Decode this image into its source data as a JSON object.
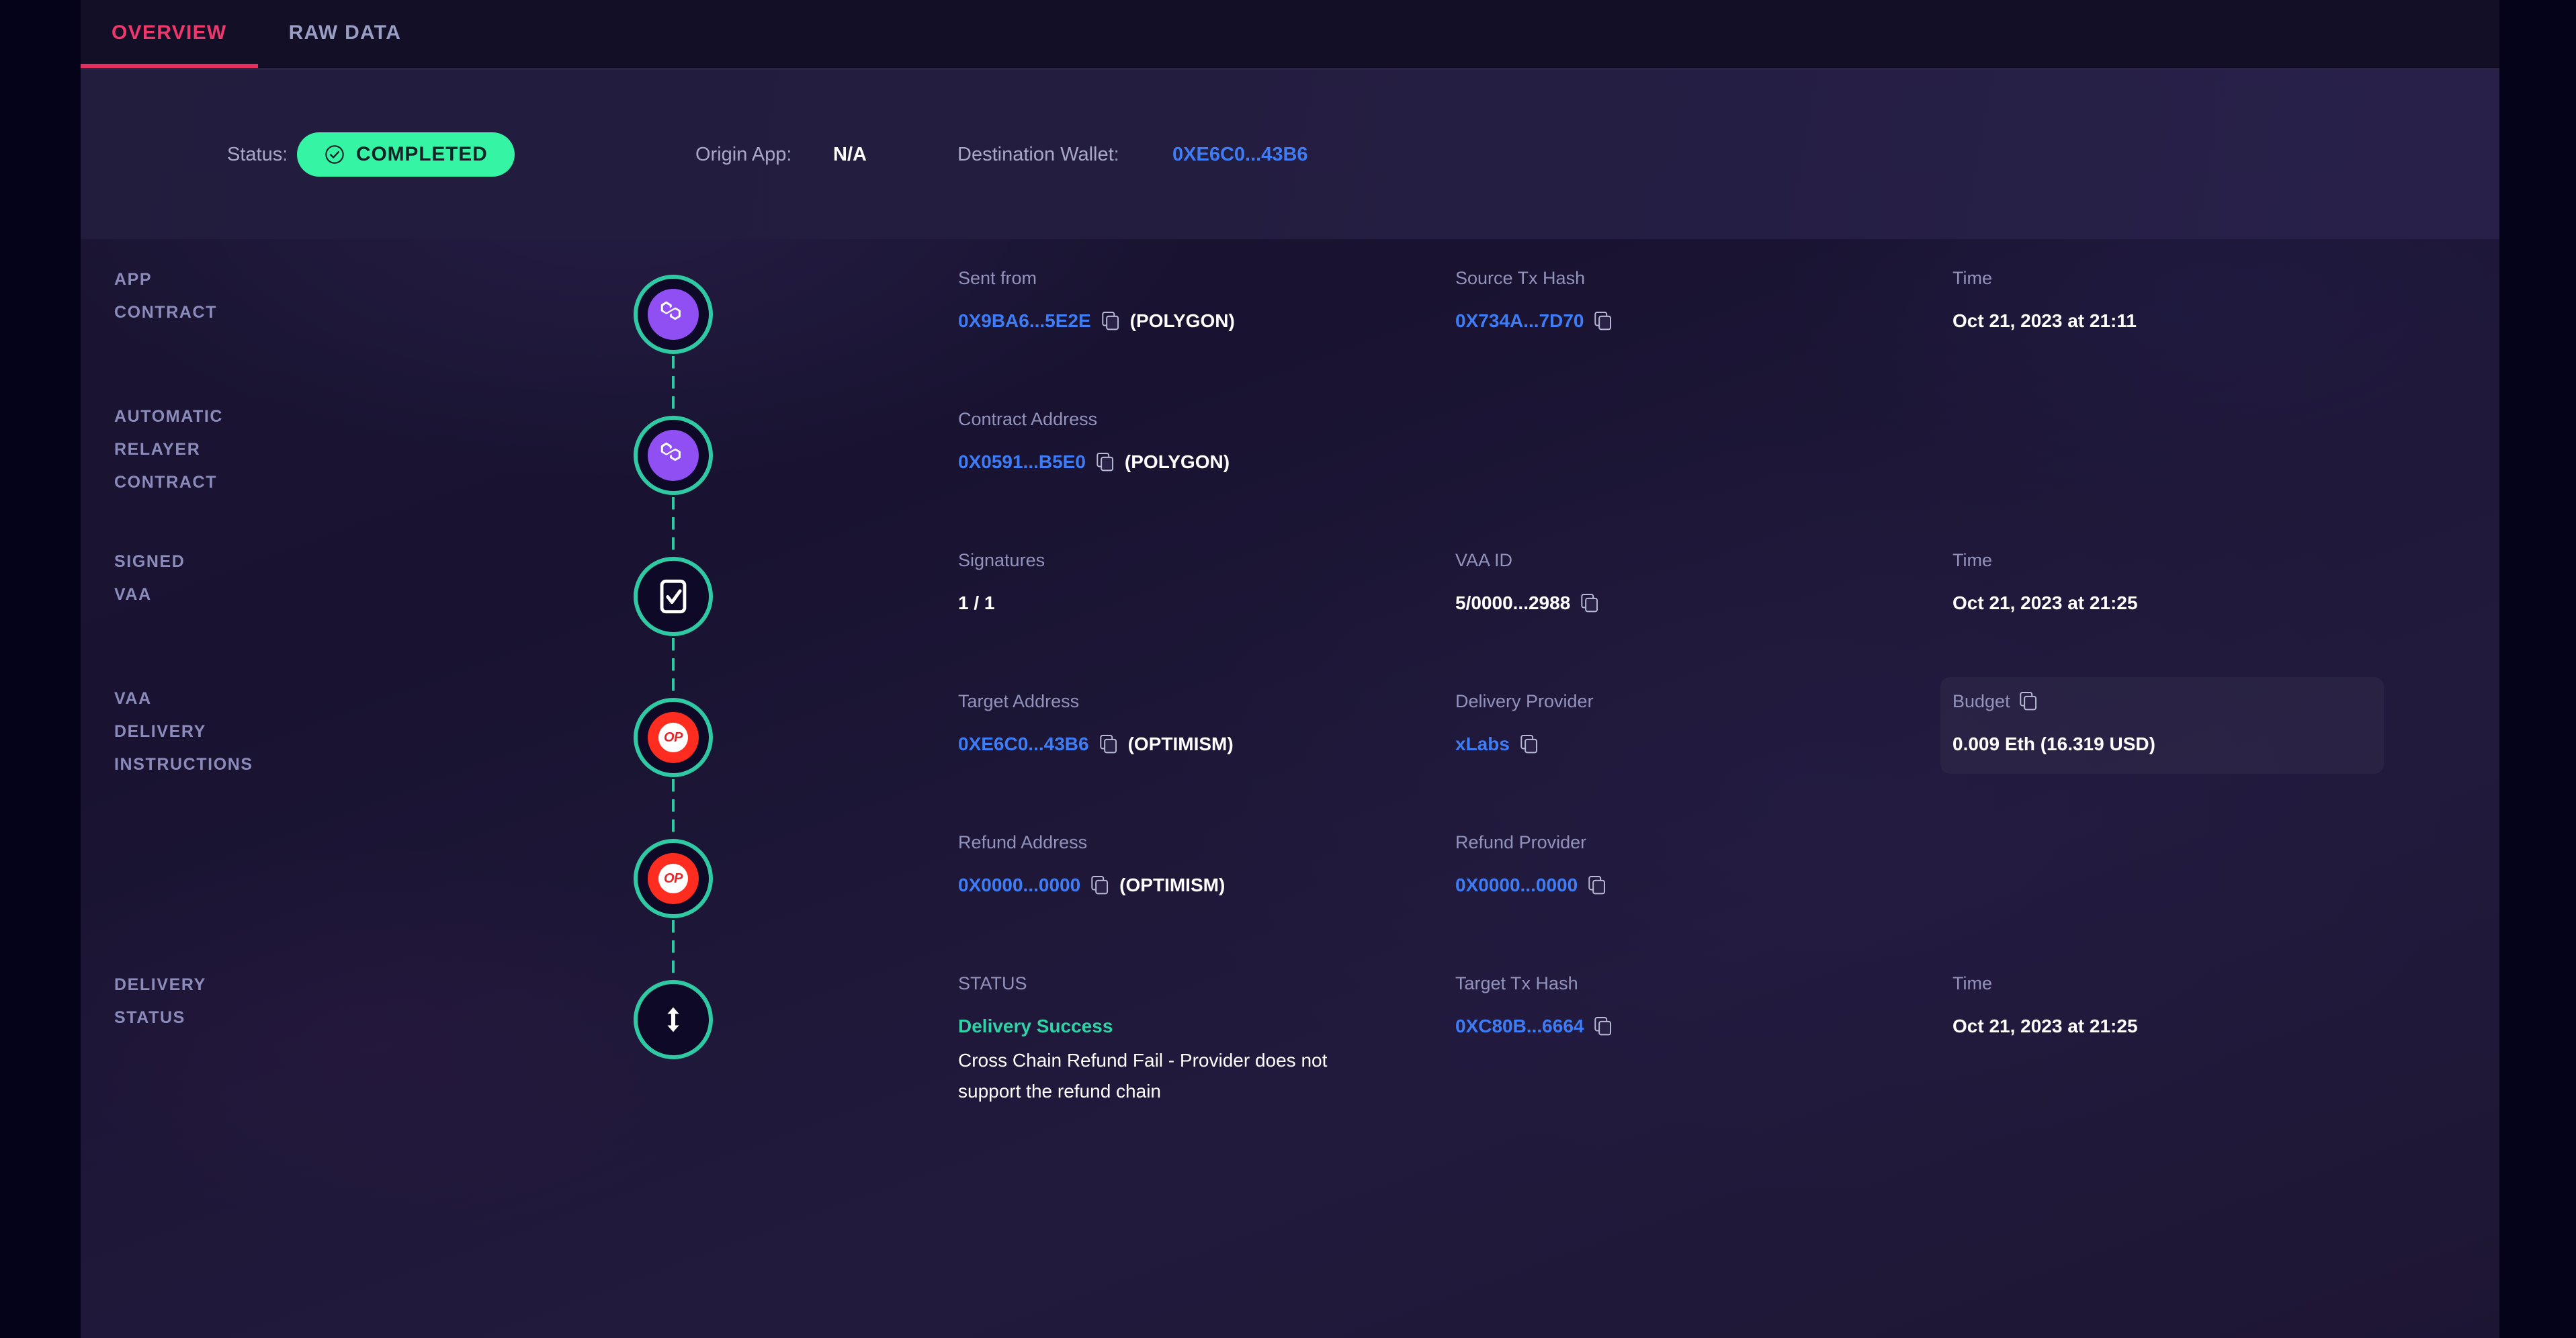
{
  "tabs": [
    {
      "label": "OVERVIEW",
      "active": true
    },
    {
      "label": "RAW DATA",
      "active": false
    }
  ],
  "summary": {
    "status_label": "Status:",
    "status_value": "COMPLETED",
    "origin_app_label": "Origin App:",
    "origin_app_value": "N/A",
    "destination_wallet_label": "Destination Wallet:",
    "destination_wallet_value": "0XE6C0...43B6"
  },
  "colors": {
    "accent_pink": "#e5305f",
    "link_blue": "#3e7df5",
    "success_green": "#35f5a5",
    "teal_ring": "#2fc9a4",
    "polygon_purple": "#8f4ff2",
    "optimism_red": "#ff2d20",
    "panel_bg": "#1b1533",
    "page_bg": "#05031a"
  },
  "rows": [
    {
      "stage": [
        "APP",
        "CONTRACT"
      ],
      "icon": "polygon-icon",
      "fields": {
        "a": {
          "label": "Sent from",
          "value": "0X9BA6...5E2E",
          "chain": "(POLYGON)",
          "copy": true
        },
        "b": {
          "label": "Source Tx Hash",
          "value": "0X734A...7D70",
          "copy": true
        },
        "c": {
          "label": "Time",
          "value": "Oct 21, 2023 at 21:11",
          "copy": false
        }
      }
    },
    {
      "stage": [
        "AUTOMATIC",
        "RELAYER",
        "CONTRACT"
      ],
      "icon": "polygon-icon",
      "fields": {
        "a": {
          "label": "Contract Address",
          "value": "0X0591...B5E0",
          "chain": "(POLYGON)",
          "copy": true
        }
      }
    },
    {
      "stage": [
        "SIGNED",
        "VAA"
      ],
      "icon": "signed-document-icon",
      "fields": {
        "a": {
          "label": "Signatures",
          "value": "1 / 1",
          "copy": false
        },
        "b": {
          "label": "VAA ID",
          "value": "5/0000...2988",
          "copy": true
        },
        "c": {
          "label": "Time",
          "value": "Oct 21, 2023 at 21:25",
          "copy": false
        }
      }
    },
    {
      "stage": [
        "VAA",
        "DELIVERY",
        "INSTRUCTIONS"
      ],
      "icon": "optimism-icon",
      "fields": {
        "a": {
          "label": "Target Address",
          "value": "0XE6C0...43B6",
          "chain": "(OPTIMISM)",
          "copy": true
        },
        "b": {
          "label": "Delivery Provider",
          "value": "xLabs",
          "copy": true
        },
        "c": {
          "label": "Budget",
          "value": "0.009 Eth (16.319 USD)",
          "label_copy": true,
          "highlight": true
        }
      }
    },
    {
      "stage": [],
      "icon": "optimism-icon",
      "fields": {
        "a": {
          "label": "Refund Address",
          "value": "0X0000...0000",
          "chain": "(OPTIMISM)",
          "copy": true
        },
        "b": {
          "label": "Refund Provider",
          "value": "0X0000...0000",
          "copy": true
        }
      }
    },
    {
      "stage": [
        "DELIVERY",
        "STATUS"
      ],
      "icon": "updown-arrow-icon",
      "fields": {
        "a": {
          "label": "STATUS",
          "value": "Delivery Success",
          "note": "Cross Chain Refund Fail - Provider does not support the refund chain"
        },
        "b": {
          "label": "Target Tx Hash",
          "value": "0XC80B...6664",
          "copy": true
        },
        "c": {
          "label": "Time",
          "value": "Oct 21, 2023 at 21:25",
          "copy": false
        }
      }
    }
  ]
}
